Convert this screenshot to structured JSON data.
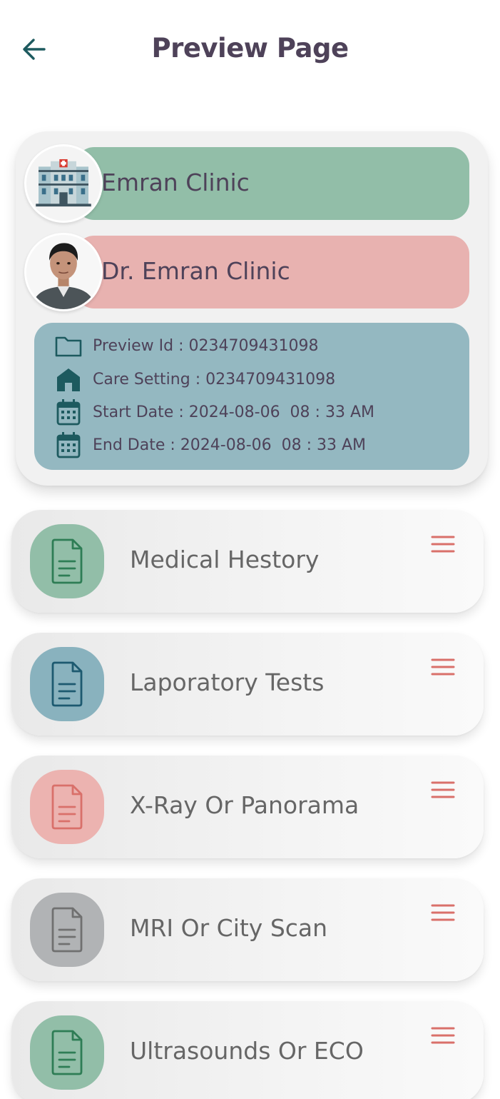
{
  "header": {
    "title": "Preview Page",
    "back_icon": "arrow-left-icon"
  },
  "clinic": {
    "name": "Emran Clinic",
    "icon": "hospital-building-icon",
    "color": "#92bea8"
  },
  "doctor": {
    "name": "Dr. Emran Clinic",
    "icon": "doctor-photo",
    "color": "#e8b2b0"
  },
  "details": {
    "color": "#94b8c1",
    "rows": [
      {
        "icon": "folder-icon",
        "text": "Preview Id : 0234709431098"
      },
      {
        "icon": "home-icon",
        "text": "Care Setting : 0234709431098"
      },
      {
        "icon": "calendar-icon",
        "text": "Start Date : 2024-08-06  08 : 33 AM"
      },
      {
        "icon": "calendar-icon",
        "text": "End Date : 2024-08-06  08 : 33 AM"
      }
    ]
  },
  "sections": [
    {
      "label": "Medical Hestory",
      "icon": "document-icon",
      "color": "#92bea8",
      "stroke": "#2e7d55"
    },
    {
      "label": "Laporatory Tests",
      "icon": "document-icon",
      "color": "#89b2be",
      "stroke": "#1d5a70"
    },
    {
      "label": "X-Ray Or Panorama",
      "icon": "document-icon",
      "color": "#ecb3b0",
      "stroke": "#d9706a"
    },
    {
      "label": "MRI Or City Scan",
      "icon": "document-icon",
      "color": "#b1b3b5",
      "stroke": "#707070"
    },
    {
      "label": "Ultrasounds Or ECO",
      "icon": "document-icon",
      "color": "#92bea8",
      "stroke": "#2e7d55"
    }
  ],
  "menu_icon": "hamburger-menu-icon",
  "accent": {
    "menu": "#d9706a",
    "detail_icons": "#1d5a5f"
  }
}
